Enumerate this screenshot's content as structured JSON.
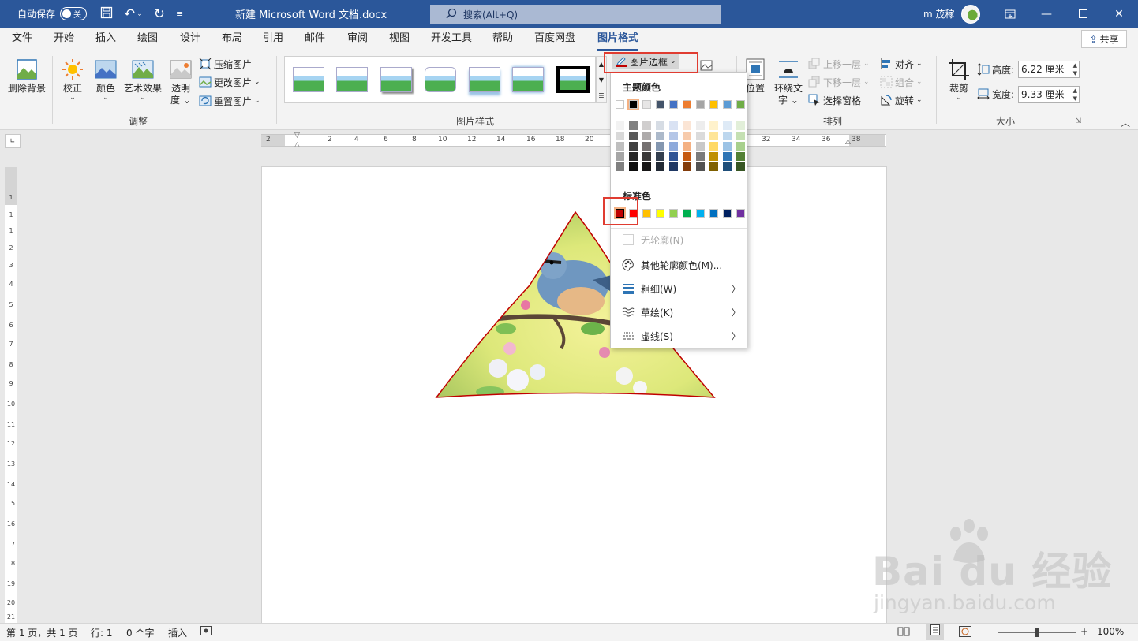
{
  "titlebar": {
    "autosave_label": "自动保存",
    "autosave_state": "关",
    "doc_title": "新建 Microsoft Word 文档.docx",
    "search_placeholder": "搜索(Alt+Q)",
    "user_name": "m 茂稼"
  },
  "menu": {
    "tabs": [
      "文件",
      "开始",
      "插入",
      "绘图",
      "设计",
      "布局",
      "引用",
      "邮件",
      "审阅",
      "视图",
      "开发工具",
      "帮助",
      "百度网盘",
      "图片格式"
    ],
    "active": "图片格式",
    "share_label": "共享"
  },
  "ribbon": {
    "adjust": {
      "remove_bg": "删除背景",
      "correct": "校正",
      "color": "颜色",
      "artistic": "艺术效果",
      "transparency_1": "透明",
      "transparency_2": "度",
      "compress": "压缩图片",
      "change": "更改图片",
      "reset": "重置图片",
      "group_label": "调整"
    },
    "styles": {
      "group_label": "图片样式",
      "border_button": "图片边框"
    },
    "arrange": {
      "position": "位置",
      "wrap_1": "环绕文",
      "wrap_2": "字",
      "bring_forward": "上移一层",
      "send_backward": "下移一层",
      "selection_pane": "选择窗格",
      "align": "对齐",
      "group": "组合",
      "rotate": "旋转",
      "group_label": "排列"
    },
    "size": {
      "crop": "裁剪",
      "height_label": "高度:",
      "height_value": "6.22 厘米",
      "width_label": "宽度:",
      "width_value": "9.33 厘米",
      "group_label": "大小"
    }
  },
  "ruler": {
    "h_labels": [
      "2",
      "2",
      "4",
      "6",
      "8",
      "10",
      "12",
      "14",
      "16",
      "18",
      "20",
      "32",
      "34",
      "36",
      "38"
    ],
    "v_labels": [
      "1",
      "1",
      "1",
      "2",
      "3",
      "4",
      "5",
      "6",
      "7",
      "8",
      "9",
      "10",
      "11",
      "12",
      "13",
      "14",
      "15",
      "16",
      "17",
      "18",
      "19",
      "20",
      "21"
    ]
  },
  "dropdown": {
    "theme_colors_label": "主题颜色",
    "standard_colors_label": "标准色",
    "no_outline": "无轮廓(N)",
    "more_colors": "其他轮廓颜色(M)...",
    "weight": "粗细(W)",
    "sketched": "草绘(K)",
    "dashes": "虚线(S)",
    "theme_top": [
      "#ffffff",
      "#000000",
      "#e7e6e6",
      "#44546a",
      "#4472c4",
      "#ed7d31",
      "#a5a5a5",
      "#ffc000",
      "#5b9bd5",
      "#70ad47"
    ],
    "theme_shades": [
      [
        "#f2f2f2",
        "#d9d9d9",
        "#bfbfbf",
        "#a6a6a6",
        "#808080"
      ],
      [
        "#808080",
        "#595959",
        "#404040",
        "#262626",
        "#0d0d0d"
      ],
      [
        "#d0cece",
        "#aeabab",
        "#757171",
        "#3a3838",
        "#171616"
      ],
      [
        "#d6dce4",
        "#acb9ca",
        "#8497b0",
        "#333f4f",
        "#222a35"
      ],
      [
        "#d9e2f3",
        "#b4c6e7",
        "#8eaadb",
        "#2f5496",
        "#1f3864"
      ],
      [
        "#fbe5d5",
        "#f7cbac",
        "#f4b183",
        "#c55a11",
        "#833c0b"
      ],
      [
        "#ededed",
        "#dbdbdb",
        "#c9c9c9",
        "#7b7b7b",
        "#525252"
      ],
      [
        "#fff2cc",
        "#fee599",
        "#ffd965",
        "#bf9000",
        "#7f6000"
      ],
      [
        "#deeaf6",
        "#bdd7ee",
        "#9cc3e5",
        "#2e75b5",
        "#1e4e79"
      ],
      [
        "#e2efd9",
        "#c5e0b3",
        "#a8d08d",
        "#538135",
        "#375623"
      ]
    ],
    "standard": [
      "#c00000",
      "#ff0000",
      "#ffc000",
      "#ffff00",
      "#92d050",
      "#00b050",
      "#00b0f0",
      "#0070c0",
      "#002060",
      "#7030a0"
    ]
  },
  "status": {
    "page": "第 1 页，共 1 页",
    "line": "行: 1",
    "words": "0 个字",
    "mode": "插入",
    "zoom_minus": "—",
    "zoom_plus": "+",
    "zoom": "100%",
    "zoom_level": 0.5
  },
  "watermark": {
    "brand": "Bai du 经验",
    "url": "jingyan.baidu.com"
  },
  "colors": {
    "title_blue": "#2b579a",
    "highlight_red": "#e03c31",
    "triangle_border": "#c00000"
  }
}
